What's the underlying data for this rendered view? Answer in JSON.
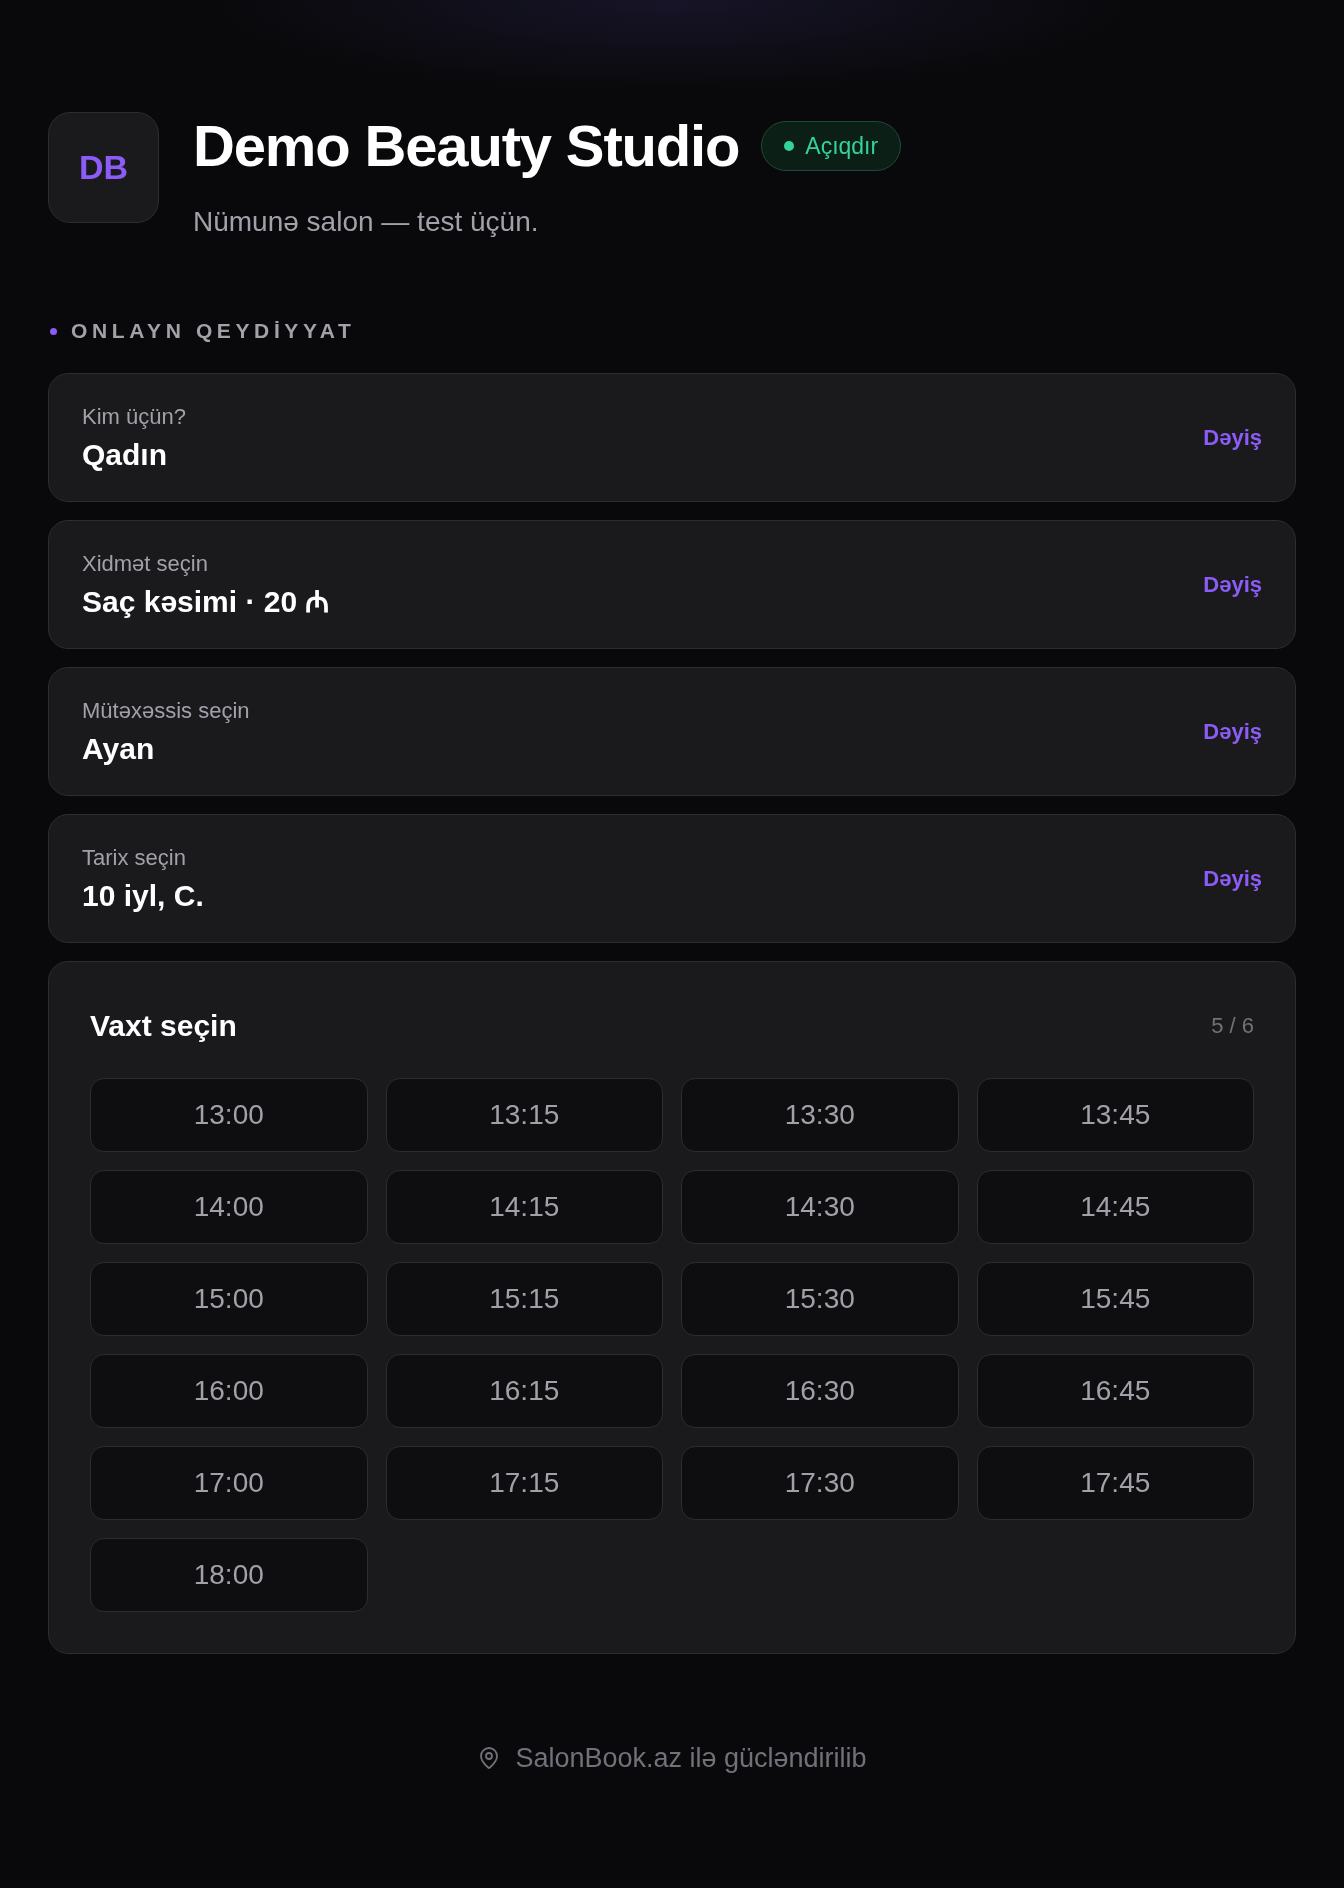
{
  "header": {
    "logo": "DB",
    "title": "Demo Beauty Studio",
    "status": {
      "label": "Açıqdır",
      "open": true
    },
    "subtitle": "Nümunə salon — test üçün."
  },
  "section": {
    "label": "ONLAYN QEYDİYYAT"
  },
  "steps": [
    {
      "label": "Kim üçün?",
      "value": "Qadın",
      "action": "Dəyiş"
    },
    {
      "label": "Xidmət seçin",
      "value": "Saç kəsimi · 20 ₼",
      "action": "Dəyiş"
    },
    {
      "label": "Mütəxəssis seçin",
      "value": "Ayan",
      "action": "Dəyiş"
    },
    {
      "label": "Tarix seçin",
      "value": "10 iyl, C.",
      "action": "Dəyiş"
    }
  ],
  "time_picker": {
    "title": "Vaxt seçin",
    "counter": "5 / 6",
    "slots": [
      {
        "time": "13:00",
        "selected": false
      },
      {
        "time": "13:15",
        "selected": false
      },
      {
        "time": "13:30",
        "selected": false
      },
      {
        "time": "13:45",
        "selected": false
      },
      {
        "time": "14:00",
        "selected": false
      },
      {
        "time": "14:15",
        "selected": false
      },
      {
        "time": "14:30",
        "selected": false
      },
      {
        "time": "14:45",
        "selected": false
      },
      {
        "time": "15:00",
        "selected": false
      },
      {
        "time": "15:15",
        "selected": false
      },
      {
        "time": "15:30",
        "selected": false
      },
      {
        "time": "15:45",
        "selected": false
      },
      {
        "time": "16:00",
        "selected": false
      },
      {
        "time": "16:15",
        "selected": false
      },
      {
        "time": "16:30",
        "selected": false
      },
      {
        "time": "16:45",
        "selected": false
      },
      {
        "time": "17:00",
        "selected": false
      },
      {
        "time": "17:15",
        "selected": false
      },
      {
        "time": "17:30",
        "selected": false
      },
      {
        "time": "17:45",
        "selected": false
      },
      {
        "time": "18:00",
        "selected": false
      }
    ]
  },
  "footer": {
    "text": "SalonBook.az ilə gücləndirilib"
  }
}
